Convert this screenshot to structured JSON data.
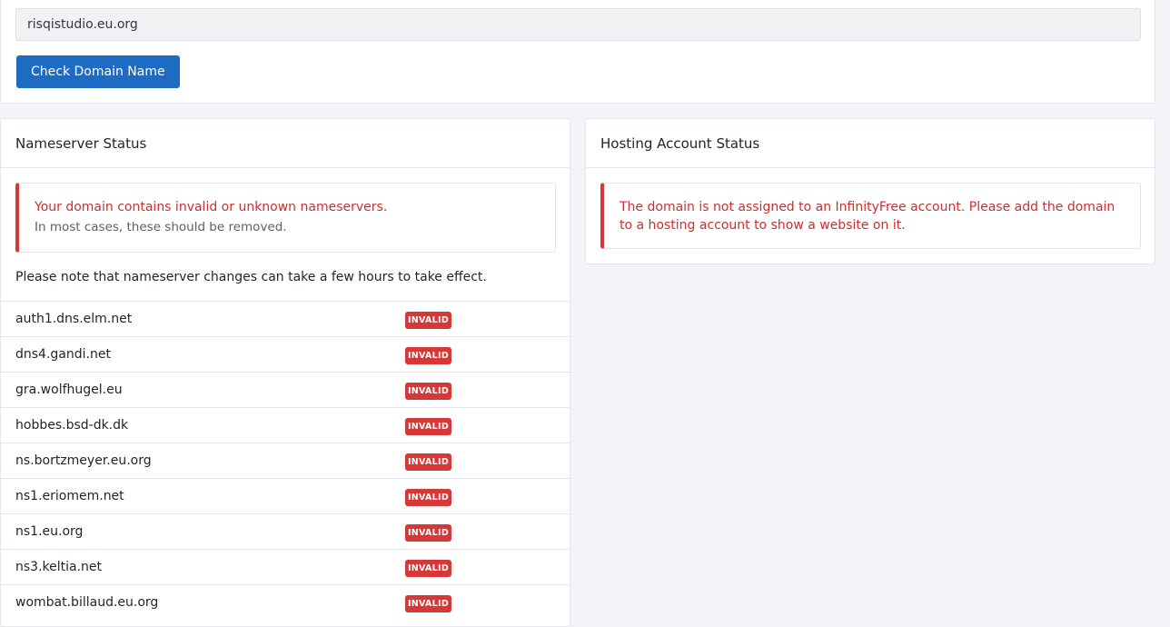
{
  "search": {
    "value": "risqistudio.eu.org",
    "button_label": "Check Domain Name"
  },
  "nameserver_card": {
    "title": "Nameserver Status",
    "alert_title": "Your domain contains invalid or unknown nameservers.",
    "alert_sub": "In most cases, these should be removed.",
    "note": "Please note that nameserver changes can take a few hours to take effect.",
    "rows": [
      {
        "name": "auth1.dns.elm.net",
        "status": "INVALID"
      },
      {
        "name": "dns4.gandi.net",
        "status": "INVALID"
      },
      {
        "name": "gra.wolfhugel.eu",
        "status": "INVALID"
      },
      {
        "name": "hobbes.bsd-dk.dk",
        "status": "INVALID"
      },
      {
        "name": "ns.bortzmeyer.eu.org",
        "status": "INVALID"
      },
      {
        "name": "ns1.eriomem.net",
        "status": "INVALID"
      },
      {
        "name": "ns1.eu.org",
        "status": "INVALID"
      },
      {
        "name": "ns3.keltia.net",
        "status": "INVALID"
      },
      {
        "name": "wombat.billaud.eu.org",
        "status": "INVALID"
      }
    ]
  },
  "hosting_card": {
    "title": "Hosting Account Status",
    "alert_text": "The domain is not assigned to an InfinityFree account. Please add the domain to a hosting account to show a website on it."
  },
  "colors": {
    "primary": "#1e6bc4",
    "danger": "#d63838",
    "background": "#f3f4f8"
  }
}
